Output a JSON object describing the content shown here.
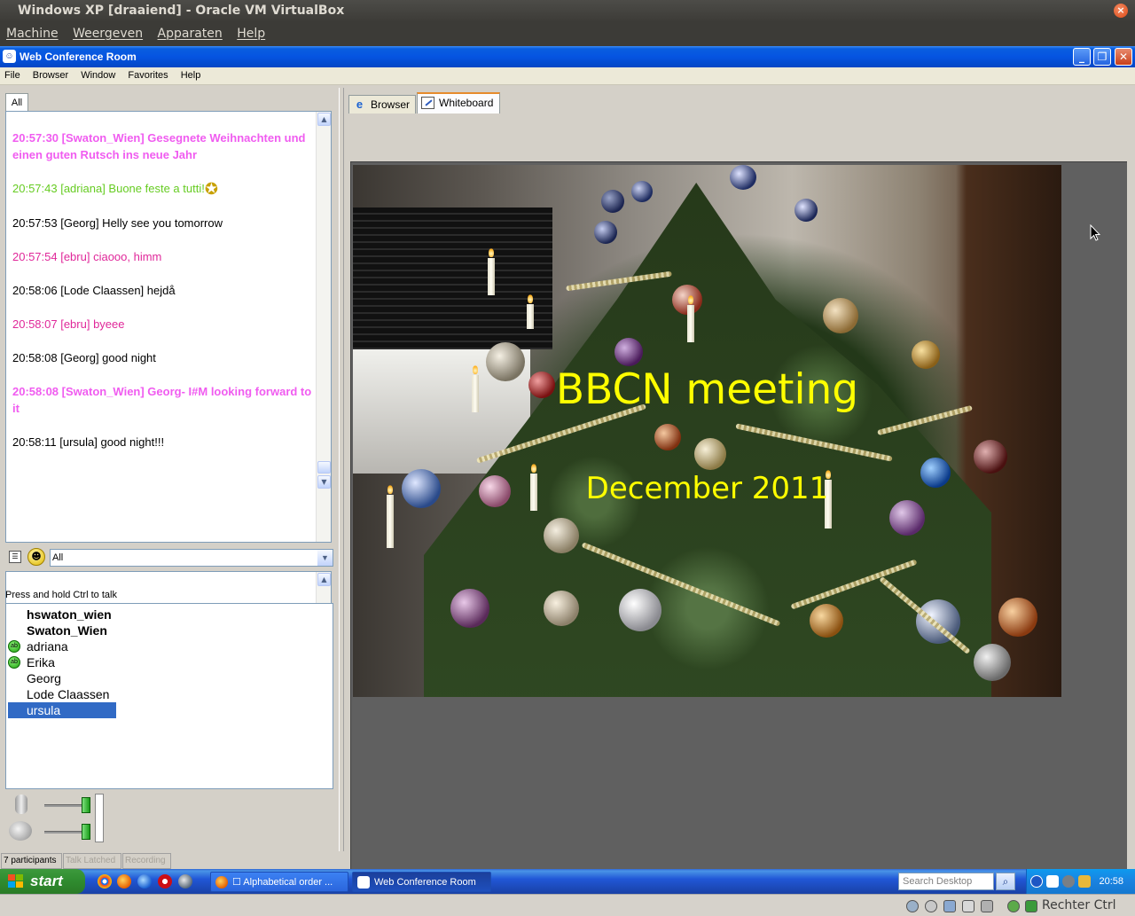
{
  "host": {
    "window_title": "Windows XP [draaiend] - Oracle VM VirtualBox",
    "menu": [
      "Machine",
      "Weergeven",
      "Apparaten",
      "Help"
    ],
    "host_key_label": "Rechter Ctrl"
  },
  "app": {
    "title": "Web Conference Room",
    "menu": [
      "File",
      "Browser",
      "Window",
      "Favorites",
      "Help"
    ]
  },
  "chat": {
    "tab_label": "All",
    "messages": [
      {
        "text": "20:57:30 [Swaton_Wien] Gesegnete Weihnachten und einen guten Rutsch ins neue Jahr",
        "color": "#f05cf0",
        "bold": true
      },
      {
        "text": "20:57:43 [adriana] Buone feste a tutti!",
        "color": "#66cc22",
        "bold": false,
        "emoticon": "star-icon"
      },
      {
        "text": "20:57:53 [Georg] Helly see you tomorrow",
        "color": "#000000",
        "bold": false
      },
      {
        "text": "20:57:54 [ebru] ciaooo, himm",
        "color": "#e0289a",
        "bold": false
      },
      {
        "text": "20:58:06 [Lode Claassen] hejdå",
        "color": "#000000",
        "bold": false
      },
      {
        "text": "20:58:07 [ebru] byeee",
        "color": "#e0289a",
        "bold": false
      },
      {
        "text": "20:58:08 [Georg] good night",
        "color": "#000000",
        "bold": false
      },
      {
        "text": "20:58:08 [Swaton_Wien] Georg- I#M looking forward to it",
        "color": "#f05cf0",
        "bold": true
      },
      {
        "text": "20:58:11 [ursula] good night!!!",
        "color": "#000000",
        "bold": false
      }
    ],
    "recipient_select": "All"
  },
  "participants": {
    "ptt_hint": "Press and hold Ctrl to talk",
    "users": [
      {
        "name": "hswaton_wien",
        "bold": true,
        "badge": false,
        "selected": false
      },
      {
        "name": "Swaton_Wien",
        "bold": true,
        "badge": false,
        "selected": false
      },
      {
        "name": "adriana",
        "bold": false,
        "badge": true,
        "selected": false
      },
      {
        "name": "Erika",
        "bold": false,
        "badge": true,
        "selected": false
      },
      {
        "name": "Georg",
        "bold": false,
        "badge": false,
        "selected": false
      },
      {
        "name": "Lode Claassen",
        "bold": false,
        "badge": false,
        "selected": false
      },
      {
        "name": "ursula",
        "bold": false,
        "badge": false,
        "selected": true
      }
    ],
    "badge_text": "ab"
  },
  "status": {
    "participants_count": "7 participants",
    "talk_latched": "Talk Latched",
    "recording": "Recording"
  },
  "tabs": {
    "browser": "Browser",
    "whiteboard": "Whiteboard"
  },
  "whiteboard": {
    "title": "BBCN meeting",
    "subtitle": "December 2011",
    "text_color": "#ffff00"
  },
  "taskbar": {
    "start_label": "start",
    "tasks": [
      {
        "label": "☐ Alphabetical order ...",
        "active": false
      },
      {
        "label": "Web Conference Room",
        "active": true
      }
    ],
    "search_placeholder": "Search Desktop",
    "clock": "20:58"
  }
}
